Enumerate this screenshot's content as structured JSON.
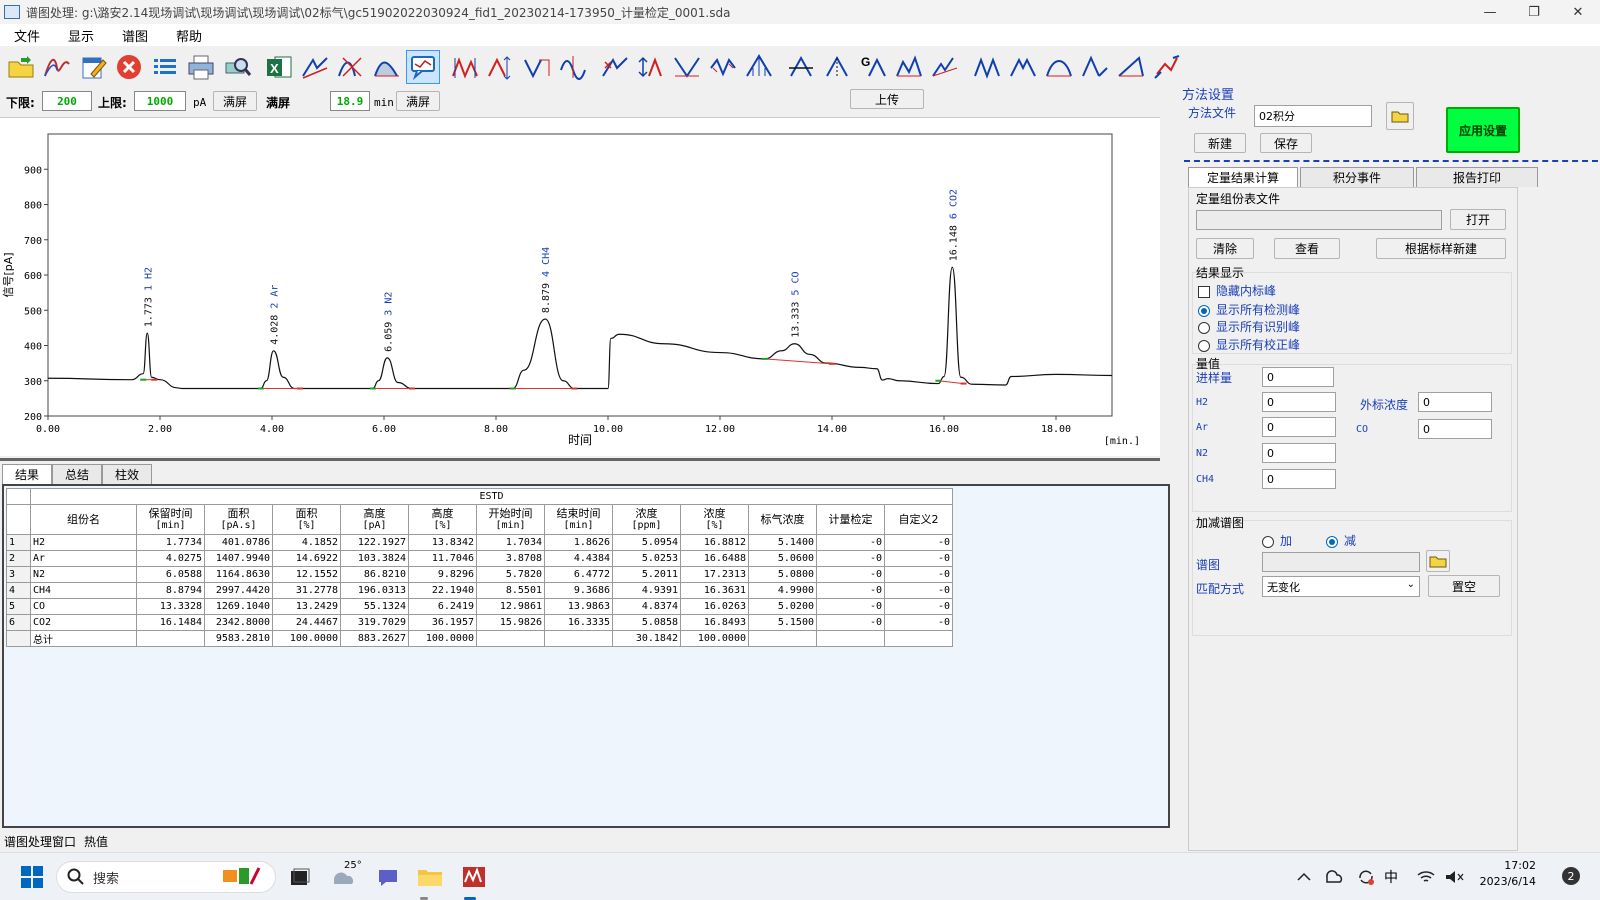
{
  "window": {
    "title": "谱图处理: g:\\潞安2.14现场调试\\现场调试\\现场调试\\02标气\\gc51902022030924_fid1_20230214-173950_计量检定_0001.sda",
    "min": "—",
    "max": "❐",
    "close": "✕"
  },
  "menu": [
    "文件",
    "显示",
    "谱图",
    "帮助"
  ],
  "limits": {
    "lower_label": "下限:",
    "lower_value": "200",
    "upper_label": "上限:",
    "upper_value": "1000",
    "pa_unit": "pA",
    "fullscreen1": "满屏",
    "fullscreen_label": "满屏",
    "time_value": "18.9",
    "min_unit": "min",
    "fullscreen2": "满屏",
    "upload": "上传"
  },
  "chart_data": {
    "type": "line",
    "xlabel": "时间",
    "xunit": "[min.]",
    "ylabel": "信号[pA]",
    "xlim": [
      0,
      19.0
    ],
    "ylim": [
      200,
      1000
    ],
    "xticks": [
      "0.00",
      "2.00",
      "4.00",
      "6.00",
      "8.00",
      "10.00",
      "12.00",
      "14.00",
      "16.00",
      "18.00"
    ],
    "yticks": [
      "200",
      "300",
      "400",
      "500",
      "600",
      "700",
      "800",
      "900"
    ],
    "series": [
      {
        "x": [
          0,
          1.5,
          1.7,
          1.773,
          1.85,
          2.0,
          2.3,
          2.4,
          3.8,
          3.9,
          4.028,
          4.2,
          4.4,
          5.8,
          5.9,
          6.059,
          6.25,
          6.5,
          8.3,
          8.5,
          8.879,
          9.2,
          9.4,
          10.0,
          10.05,
          10.2,
          11.0,
          12.0,
          12.8,
          13.1,
          13.333,
          13.6,
          13.9,
          14.5,
          14.8,
          14.9,
          15.0,
          15.2,
          15.9,
          16.0,
          16.148,
          16.3,
          16.5,
          17.1,
          17.2,
          18.0,
          19.0
        ],
        "y": [
          307,
          303,
          320,
          435,
          310,
          303,
          280,
          278,
          278,
          300,
          385,
          310,
          278,
          278,
          300,
          365,
          295,
          278,
          278,
          330,
          475,
          300,
          278,
          278,
          420,
          432,
          405,
          380,
          362,
          385,
          405,
          375,
          350,
          338,
          334,
          302,
          306,
          300,
          292,
          312,
          622,
          310,
          290,
          288,
          312,
          318,
          315
        ]
      }
    ],
    "peak_labels": [
      {
        "x": 1.773,
        "y": 435,
        "rt": "1.773",
        "id": "1",
        "name": "H2"
      },
      {
        "x": 4.028,
        "y": 385,
        "rt": "4.028",
        "id": "2",
        "name": "Ar"
      },
      {
        "x": 6.059,
        "y": 365,
        "rt": "6.059",
        "id": "3",
        "name": "N2"
      },
      {
        "x": 8.879,
        "y": 475,
        "rt": "8.879",
        "id": "4",
        "name": "CH4"
      },
      {
        "x": 13.333,
        "y": 405,
        "rt": "13.333",
        "id": "5",
        "name": "CO"
      },
      {
        "x": 16.148,
        "y": 622,
        "rt": "16.148",
        "id": "6",
        "name": "CO2"
      }
    ],
    "baselines": [
      [
        1.7,
        303,
        1.9,
        303
      ],
      [
        3.8,
        278,
        4.5,
        278
      ],
      [
        5.8,
        278,
        6.5,
        278
      ],
      [
        8.3,
        278,
        9.4,
        278
      ],
      [
        12.8,
        362,
        14.0,
        348
      ],
      [
        15.9,
        300,
        16.35,
        292
      ]
    ]
  },
  "bottom_tabs": [
    "结果",
    "总结",
    "柱效"
  ],
  "results": {
    "method": "ESTD",
    "headers": [
      {
        "name": "组份名",
        "unit": ""
      },
      {
        "name": "保留时间",
        "unit": "[min]"
      },
      {
        "name": "面积",
        "unit": "[pA.s]"
      },
      {
        "name": "面积",
        "unit": "[%]"
      },
      {
        "name": "高度",
        "unit": "[pA]"
      },
      {
        "name": "高度",
        "unit": "[%]"
      },
      {
        "name": "开始时间",
        "unit": "[min]"
      },
      {
        "name": "结束时间",
        "unit": "[min]"
      },
      {
        "name": "浓度",
        "unit": "[ppm]"
      },
      {
        "name": "浓度",
        "unit": "[%]"
      },
      {
        "name": "标气浓度",
        "unit": ""
      },
      {
        "name": "计量检定",
        "unit": ""
      },
      {
        "name": "自定义2",
        "unit": ""
      }
    ],
    "rows": [
      [
        "1",
        "H2",
        "1.7734",
        "401.0786",
        "4.1852",
        "122.1927",
        "13.8342",
        "1.7034",
        "1.8626",
        "5.0954",
        "16.8812",
        "5.1400",
        "-0",
        "-0"
      ],
      [
        "2",
        "Ar",
        "4.0275",
        "1407.9940",
        "14.6922",
        "103.3824",
        "11.7046",
        "3.8708",
        "4.4384",
        "5.0253",
        "16.6488",
        "5.0600",
        "-0",
        "-0"
      ],
      [
        "3",
        "N2",
        "6.0588",
        "1164.8630",
        "12.1552",
        "86.8210",
        "9.8296",
        "5.7820",
        "6.4772",
        "5.2011",
        "17.2313",
        "5.0800",
        "-0",
        "-0"
      ],
      [
        "4",
        "CH4",
        "8.8794",
        "2997.4420",
        "31.2778",
        "196.0313",
        "22.1940",
        "8.5501",
        "9.3686",
        "4.9391",
        "16.3631",
        "4.9900",
        "-0",
        "-0"
      ],
      [
        "5",
        "CO",
        "13.3328",
        "1269.1040",
        "13.2429",
        "55.1324",
        "6.2419",
        "12.9861",
        "13.9863",
        "4.8374",
        "16.0263",
        "5.0200",
        "-0",
        "-0"
      ],
      [
        "6",
        "CO2",
        "16.1484",
        "2342.8000",
        "24.4467",
        "319.7029",
        "36.1957",
        "15.9826",
        "16.3335",
        "5.0858",
        "16.8493",
        "5.1500",
        "-0",
        "-0"
      ]
    ],
    "total": [
      "",
      "总计",
      "",
      "9583.2810",
      "100.0000",
      "883.2627",
      "100.0000",
      "",
      "",
      "30.1842",
      "100.0000",
      "",
      "",
      ""
    ]
  },
  "status": {
    "left": "谱图处理窗口",
    "right": "热值"
  },
  "method_panel": {
    "title": "方法设置",
    "file_label": "方法文件",
    "file_value": "02积分",
    "new": "新建",
    "save": "保存",
    "apply": "应用设置",
    "apply_color": "#00ff40",
    "tabs": [
      "定量结果计算",
      "积分事件",
      "报告打印"
    ],
    "quant_table_label": "定量组份表文件",
    "open": "打开",
    "clear": "清除",
    "view": "查看",
    "new_from_std": "根据标样新建",
    "result_display": "结果显示",
    "opt_hide": "隐藏内标峰",
    "opt_all_detected": "显示所有检测峰",
    "opt_all_identified": "显示所有识别峰",
    "opt_all_corrected": "显示所有校正峰",
    "values_label": "量值",
    "injection_label": "进样量",
    "injection_value": "0",
    "ext_std_label": "外标浓度",
    "ext_std_value": "0",
    "comp_fields": [
      {
        "name": "H2",
        "value": "0"
      },
      {
        "name": "Ar",
        "value": "0"
      },
      {
        "name": "N2",
        "value": "0"
      },
      {
        "name": "CH4",
        "value": "0"
      }
    ],
    "co_label": "CO",
    "co_value": "0",
    "subtract_label": "加减谱图",
    "add": "加",
    "subtract": "减",
    "chromatogram_label": "谱图",
    "match_label": "匹配方式",
    "match_value": "无变化",
    "clear_btn": "置空"
  },
  "taskbar": {
    "search": "搜索",
    "weather_temp": "25°",
    "ime": "中",
    "time": "17:02",
    "date": "2023/6/14",
    "notif": "2"
  }
}
